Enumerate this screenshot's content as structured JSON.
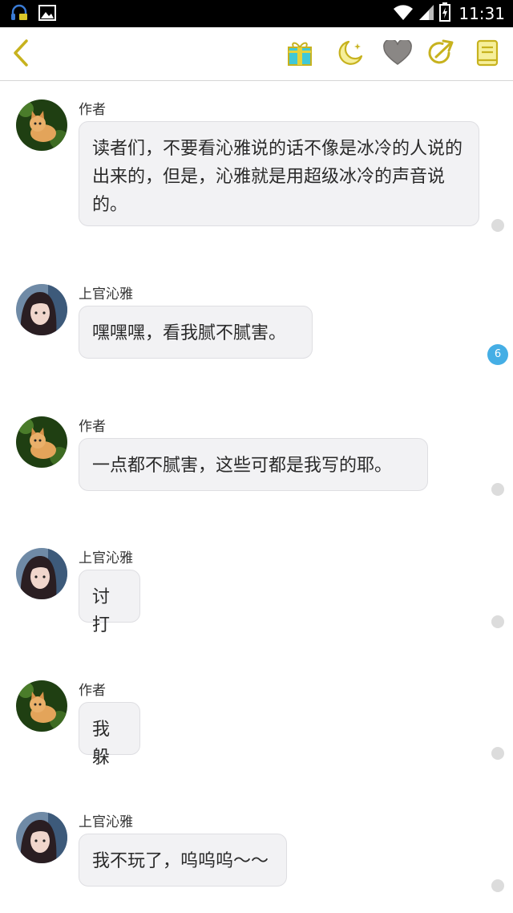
{
  "status_bar": {
    "time": "11:31"
  },
  "toolbar": {
    "back_icon": "chevron-left-icon",
    "gift_icon": "gift-icon",
    "night_icon": "moon-icon",
    "like_icon": "heart-icon",
    "share_icon": "share-icon",
    "catalog_icon": "book-icon",
    "accent_color": "#c7b21e"
  },
  "messages": [
    {
      "sender": "作者",
      "avatar": "cat-avatar",
      "text": "读者们，不要看沁雅说的话不像是冰冷的人说的出来的，但是，沁雅就是用超级冰冷的声音说的。"
    },
    {
      "sender": "上官沁雅",
      "avatar": "girl-avatar",
      "text": "嘿嘿嘿，看我腻不腻害。"
    },
    {
      "sender": "作者",
      "avatar": "cat-avatar",
      "text": "一点都不腻害，这些可都是我写的耶。"
    },
    {
      "sender": "上官沁雅",
      "avatar": "girl-avatar",
      "text": "讨打"
    },
    {
      "sender": "作者",
      "avatar": "cat-avatar",
      "text": "我躲"
    },
    {
      "sender": "上官沁雅",
      "avatar": "girl-avatar",
      "text": "我不玩了，呜呜呜～～"
    }
  ],
  "comment_badge": {
    "count": "6",
    "color": "#45aee5"
  }
}
